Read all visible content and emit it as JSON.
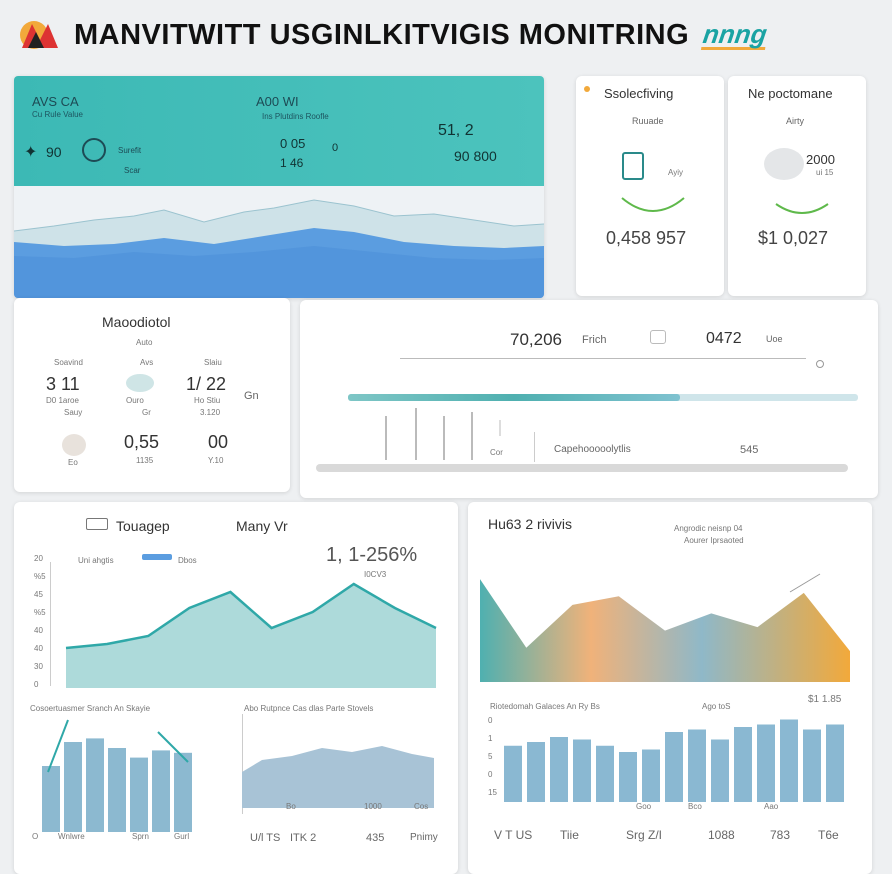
{
  "header": {
    "title": "MANVITWITT USGINLKITVIGIS MONITRING",
    "badge": "nnng",
    "colors": {
      "teal": "#3cb9b5",
      "blue": "#5b9de0",
      "orange": "#f2a93b"
    }
  },
  "hero": {
    "left_title": "AVS CA",
    "left_sub": "Cu Rule Value",
    "left_metric": "90",
    "left_metric_label": "Surefit",
    "left_metric_sub": "Scar",
    "mid_title": "A00 WI",
    "mid_sub": "Ins Plutdins   Roofle",
    "mid_value_a": "0 05",
    "mid_value_b": "0",
    "mid_value_c": "1 46",
    "right_value_a": "51, 2",
    "right_value_b": "90 800"
  },
  "sub_card_1": {
    "title": "Ssolecfiving",
    "subtitle": "Ruuade",
    "icon_label": "Ayiy",
    "value": "0,458 957"
  },
  "sub_card_2": {
    "title": "Ne poctomane",
    "subtitle": "Airty",
    "value_top": "2000",
    "value_top_sub": "ui 15",
    "value": "$1 0,027"
  },
  "mid_left": {
    "title": "Maoodiotol",
    "subtitle": "Auto",
    "col_labels": [
      "Soavind",
      "Avs",
      "Slaiu"
    ],
    "stats": [
      {
        "value": "3 11",
        "sub1": "D0 1aroe",
        "sub2": "Sauy"
      },
      {
        "value": "",
        "sub1": "Ouro",
        "sub2": "Gr"
      },
      {
        "value": "1/ 22",
        "sub1": "Ho Stiu",
        "sub2": "3.120"
      }
    ],
    "unit": "Gn",
    "bottom": [
      {
        "value": "",
        "sub": "Eo"
      },
      {
        "value": "0,55",
        "sub": "1135"
      },
      {
        "value": "00",
        "sub": "Y.10"
      }
    ]
  },
  "mid_right": {
    "value_a": "70,206",
    "value_a_unit": "Frich",
    "value_b": "0472",
    "value_b_unit": "Uoe",
    "footer_a": "Cor",
    "footer_b": "Capehooooolytlis",
    "footer_c": "545",
    "progress_fraction": 0.65
  },
  "bottom_left": {
    "title": "Touagep",
    "subtitle": "Many Vr",
    "kpi": "1, 1-256%",
    "kpi_sub": "I0CV3",
    "legend": [
      "Uni ahgtis",
      "Dbos"
    ],
    "chart_data": {
      "type": "area",
      "y_ticks": [
        "20",
        "%5",
        "45",
        "%5",
        "40",
        "40",
        "30",
        "0"
      ],
      "values": [
        20,
        22,
        26,
        40,
        48,
        30,
        38,
        52,
        40,
        30
      ]
    },
    "sub_left_title": "Cosoertuasmer Sranch An Skayie",
    "sub_left_x": [
      "O",
      "Wnlwre",
      "Sprn",
      "Gurl"
    ],
    "sub_left_bars": [
      55,
      75,
      78,
      70,
      62,
      68,
      66
    ],
    "sub_right_title": "Abo   Rutpnce   Cas dlas Parte Stovels",
    "sub_right_x": [
      "Bo",
      "1000",
      "Cos"
    ],
    "footer_labels": [
      "U/l TS",
      "ITK 2",
      "435",
      "Pnimy"
    ]
  },
  "bottom_right": {
    "title": "Hu63 2 rivivis",
    "note_a": "Angrodic neisnp 04",
    "note_b": "Aourer Iprsaoted",
    "chart_data": {
      "type": "area",
      "values": [
        60,
        20,
        45,
        50,
        30,
        40,
        32,
        52,
        18
      ]
    },
    "tick_right": "$1 1.85",
    "bars_title": "Riotedomah Galaces  An  Ry Bs",
    "bars_note": "Ago  toS",
    "bars_y": [
      "0",
      "1",
      "5",
      "0",
      "15"
    ],
    "bars": [
      45,
      48,
      52,
      50,
      45,
      40,
      42,
      56,
      58,
      50,
      60,
      62,
      66,
      58,
      62
    ],
    "bars_x": [
      "Goo",
      "Bco",
      "Aao"
    ],
    "footer_labels": [
      "V  T US",
      "Tiie",
      "Srg Z/I",
      "1088",
      "783",
      "T6e"
    ]
  }
}
